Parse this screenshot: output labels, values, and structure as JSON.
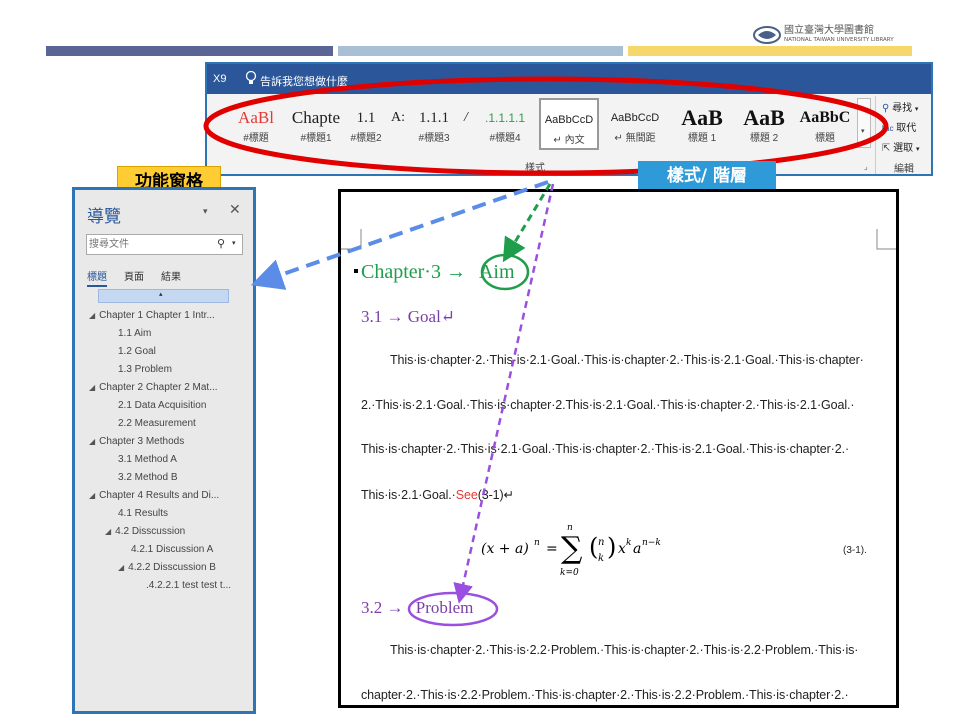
{
  "header": {
    "logo_zh": "國立臺灣大學圖書館",
    "logo_en": "NATIONAL TAIWAN UNIVERSITY LIBRARY",
    "bar_colors": [
      "#5b6595",
      "#a9bfd6",
      "#f6d76b"
    ]
  },
  "ribbon": {
    "tab_label": "X9",
    "tell_me": "告訴我您想做什麼",
    "styles": [
      {
        "preview": "AaBl",
        "name": "#標題",
        "color": "#e53935"
      },
      {
        "preview": "Chapte",
        "name": "#標題1",
        "color": "#222222"
      },
      {
        "preview": "1.1",
        "name": "#標題2",
        "color": "#222222"
      },
      {
        "preview": "A:",
        "name": "",
        "color": "#222222"
      },
      {
        "preview": "1.1.1",
        "name": "#標題3",
        "color": "#222222"
      },
      {
        "preview": "/",
        "name": "",
        "color": "#222222"
      },
      {
        "preview": ".1.1.1.1",
        "name": "#標題4",
        "color": "#2e9d4c"
      },
      {
        "preview": "AaBbCcD",
        "name": "↵ 內文",
        "color": "#222222"
      },
      {
        "preview": "AaBbCcD",
        "name": "↵ 無間距",
        "color": "#222222"
      },
      {
        "preview": "AaB",
        "name": "標題 1",
        "color": "#111111"
      },
      {
        "preview": "AaB",
        "name": "標題 2",
        "color": "#111111"
      },
      {
        "preview": "AaBbC",
        "name": "標題",
        "color": "#111111"
      }
    ],
    "group_label": "樣式",
    "editing": {
      "find": "尋找",
      "replace": "取代",
      "select": "選取",
      "group_label": "編輯"
    }
  },
  "callouts": {
    "nav_label": "功能窗格",
    "style_label": "樣式/ 階層"
  },
  "nav": {
    "title": "導覽",
    "search_placeholder": "搜尋文件",
    "tabs": [
      "標題",
      "頁面",
      "結果"
    ],
    "tree": [
      {
        "text": "Chapter 1 Chapter 1 Intr...",
        "level": 0,
        "expandable": true
      },
      {
        "text": "1.1 Aim",
        "level": 1,
        "expandable": false
      },
      {
        "text": "1.2 Goal",
        "level": 1,
        "expandable": false
      },
      {
        "text": "1.3 Problem",
        "level": 1,
        "expandable": false
      },
      {
        "text": "Chapter 2 Chapter 2 Mat...",
        "level": 0,
        "expandable": true
      },
      {
        "text": "2.1 Data Acquisition",
        "level": 1,
        "expandable": false
      },
      {
        "text": "2.2 Measurement",
        "level": 1,
        "expandable": false
      },
      {
        "text": "Chapter 3 Methods",
        "level": 0,
        "expandable": true
      },
      {
        "text": "3.1 Method A",
        "level": 1,
        "expandable": false
      },
      {
        "text": "3.2 Method B",
        "level": 1,
        "expandable": false
      },
      {
        "text": "Chapter 4 Results and Di...",
        "level": 0,
        "expandable": true
      },
      {
        "text": "4.1 Results",
        "level": 1,
        "expandable": false
      },
      {
        "text": "4.2 Disscussion",
        "level": 1,
        "expandable": true
      },
      {
        "text": "4.2.1 Discussion A",
        "level": 2,
        "expandable": false
      },
      {
        "text": "4.2.2 Disscussion B",
        "level": 2,
        "expandable": true
      },
      {
        "text": ".4.2.2.1 test test t...",
        "level": 3,
        "expandable": false
      }
    ]
  },
  "doc": {
    "h1_prefix": "Chapter·3 →",
    "h1_word": "Aim",
    "h2a": "3.1 → Goal↵",
    "para1": [
      "This·is·chapter·2.·This·is·2.1·Goal.·This·is·chapter·2.·This·is·2.1·Goal.·This·is·chapter·",
      "2.·This·is·2.1·Goal.·This·is·chapter·2.This·is·2.1·Goal.·This·is·chapter·2.·This·is·2.1·Goal.·",
      "This·is·chapter·2.·This·is·2.1·Goal.·This·is·chapter·2.·This·is·2.1·Goal.·This·is·chapter·2.·"
    ],
    "para1_last_a": "This·is·2.1·Goal.·",
    "para1_last_see": "See",
    "para1_last_b": "(3‐1)↵",
    "eq_number": "(3‐1).",
    "h2b_prefix": "3.2 →",
    "h2b_word": "Problem",
    "para2": [
      "This·is·chapter·2.·This·is·2.2·Problem.·This·is·chapter·2.·This·is·2.2·Problem.·This·is·",
      "chapter·2.·This·is·2.2·Problem.·This·is·chapter·2.·This·is·2.2·Problem.·This·is·chapter·2.·"
    ]
  }
}
